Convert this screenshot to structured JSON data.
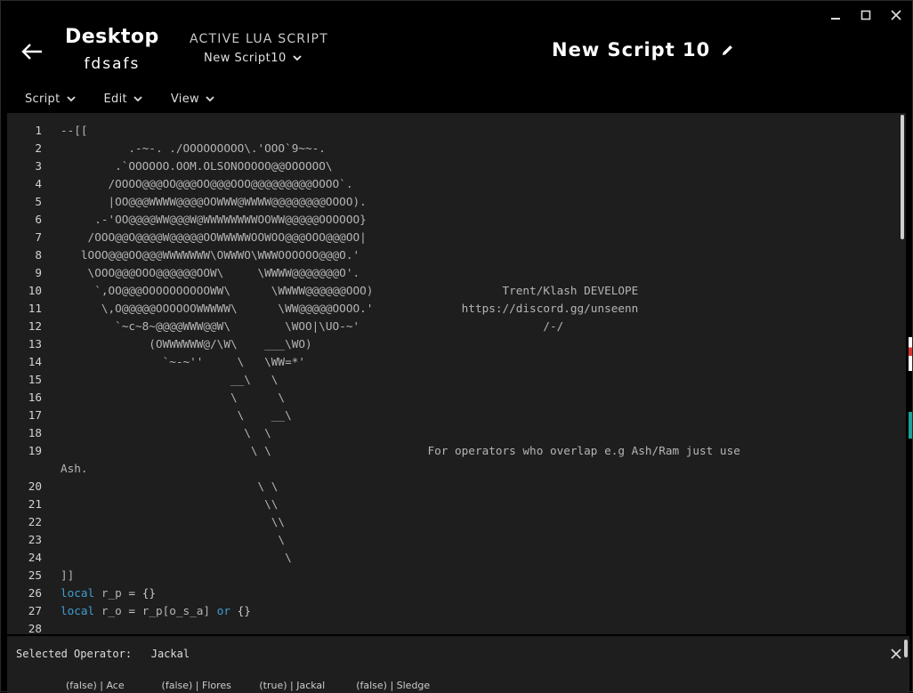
{
  "window": {
    "minimize_icon": "minimize-icon",
    "maximize_icon": "maximize-icon",
    "close_icon": "close-icon"
  },
  "header": {
    "back_icon": "arrow-left-icon",
    "device_name": "Desktop",
    "device_sub": "fdsafs",
    "active_label": "ACTIVE LUA SCRIPT",
    "active_script": "New Script10",
    "script_title": "New Script 10",
    "edit_icon": "pencil-icon"
  },
  "menu": [
    {
      "label": "Script"
    },
    {
      "label": "Edit"
    },
    {
      "label": "View"
    }
  ],
  "code_lines": [
    {
      "n": "1",
      "t": "--[["
    },
    {
      "n": "2",
      "t": "          .-~-. ./OOOOOOOOO\\.'OOO`9~~-."
    },
    {
      "n": "3",
      "t": "        .`OOOOOO.OOM.OLSONOOOOO@@OOOOOO\\"
    },
    {
      "n": "4",
      "t": "       /OOOO@@@OO@@@OO@@@OOO@@@@@@@@@OOOO`."
    },
    {
      "n": "5",
      "t": "       |OO@@@WWWW@@@@OOWWW@WWWW@@@@@@@@OOOO)."
    },
    {
      "n": "6",
      "t": "     .-'OO@@@@WW@@@W@WWWWWWWWOOWW@@@@@OOOOOO}"
    },
    {
      "n": "7",
      "t": "    /OOO@@O@@@@W@@@@@OOWWWWWOOWOO@@@OOO@@@OO|"
    },
    {
      "n": "8",
      "t": "   lOOO@@@OO@@@WWWWWWW\\OWWWO\\WWWOOOOOO@@@O.'"
    },
    {
      "n": "9",
      "t": "    \\OOO@@@OOO@@@@@@OOW\\     \\WWWW@@@@@@@O'."
    },
    {
      "n": "10",
      "t": "     `,OO@@@OOOOOOOOOOWW\\      \\WWWW@@@@@@OOO)                   Trent/Klash DEVELOPE"
    },
    {
      "n": "11",
      "t": "      \\,O@@@@@OOOOOOWWWWW\\      \\WW@@@@@OOOO.'             https://discord.gg/unseenn"
    },
    {
      "n": "12",
      "t": "        `~c~8~@@@@WWW@@W\\        \\WOO|\\UO-~'                           /-/"
    },
    {
      "n": "13",
      "t": "             (OWWWWWW@/\\W\\    ___\\WO)"
    },
    {
      "n": "14",
      "t": "               `~-~''     \\   \\WW=*'"
    },
    {
      "n": "15",
      "t": "                         __\\   \\"
    },
    {
      "n": "16",
      "t": "                         \\      \\"
    },
    {
      "n": "17",
      "t": "                          \\    __\\"
    },
    {
      "n": "18",
      "t": "                           \\  \\"
    },
    {
      "n": "19",
      "t": "                            \\ \\                       For operators who overlap e.g Ash/Ram just use",
      "wrap": "Ash."
    },
    {
      "n": "20",
      "t": "                             \\ \\"
    },
    {
      "n": "21",
      "t": "                              \\\\"
    },
    {
      "n": "22",
      "t": "                               \\\\"
    },
    {
      "n": "23",
      "t": "                                \\"
    },
    {
      "n": "24",
      "t": "                                 \\"
    },
    {
      "n": "25",
      "t": "]]"
    },
    {
      "n": "26",
      "t": "",
      "lua": "r_p = {}"
    },
    {
      "n": "27",
      "t": "",
      "lua": "r_o = r_p[o_s_a] or {}"
    },
    {
      "n": "28",
      "t": ""
    }
  ],
  "lua": {
    "local_kw": "local",
    "or_kw": "or",
    "l26_var": "r_p",
    "l26_eq": "=",
    "l26_val": "{}",
    "l27_var": "r_o",
    "l27_eq": "=",
    "l27_expr": "r_p[o_s_a]",
    "l27_val": "{}"
  },
  "panel": {
    "selected_label": "Selected Operator:",
    "selected_value": "Jackal",
    "close_icon": "close-icon",
    "operators_line": "(false) | Ace            (false) | Flores         (true) | Jackal          (false) | Sledge"
  },
  "colors": {
    "background": "#000000",
    "editor_bg": "#1e1e1e",
    "keyword": "#3f9fd0",
    "code_text": "#b5b5b5"
  }
}
